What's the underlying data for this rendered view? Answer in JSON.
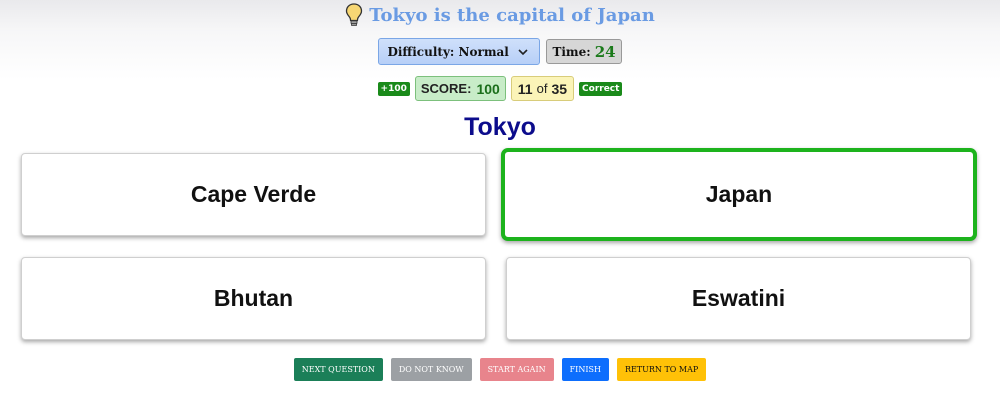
{
  "header": {
    "icon": "lightbulb-icon",
    "title": "Tokyo is the capital of Japan"
  },
  "controls": {
    "difficulty_selected": "Difficulty: Normal",
    "timer_label": "Time:",
    "timer_value": "24"
  },
  "status": {
    "points_gain": "+100",
    "score_label": "SCORE:",
    "score_value": "100",
    "progress_current": "11",
    "progress_of": "of",
    "progress_total": "35",
    "result": "Correct"
  },
  "question": "Tokyo",
  "answers": [
    {
      "label": "Cape Verde",
      "state": "normal"
    },
    {
      "label": "Japan",
      "state": "correct"
    },
    {
      "label": "Bhutan",
      "state": "normal"
    },
    {
      "label": "Eswatini",
      "state": "normal"
    }
  ],
  "buttons": {
    "next": "Next Question",
    "dont_know": "Do Not Know",
    "start_again": "Start Again",
    "finish": "Finish",
    "return_map": "Return to Map"
  },
  "colors": {
    "title": "#6a9be3",
    "question": "#0c0c8c",
    "correct_border": "#1db31d",
    "next_btn": "#1b7f58",
    "dont_know_btn": "#9ca0a4",
    "start_again_btn": "#e8848c",
    "finish_btn": "#0d6efd",
    "return_map_btn": "#ffc107"
  }
}
